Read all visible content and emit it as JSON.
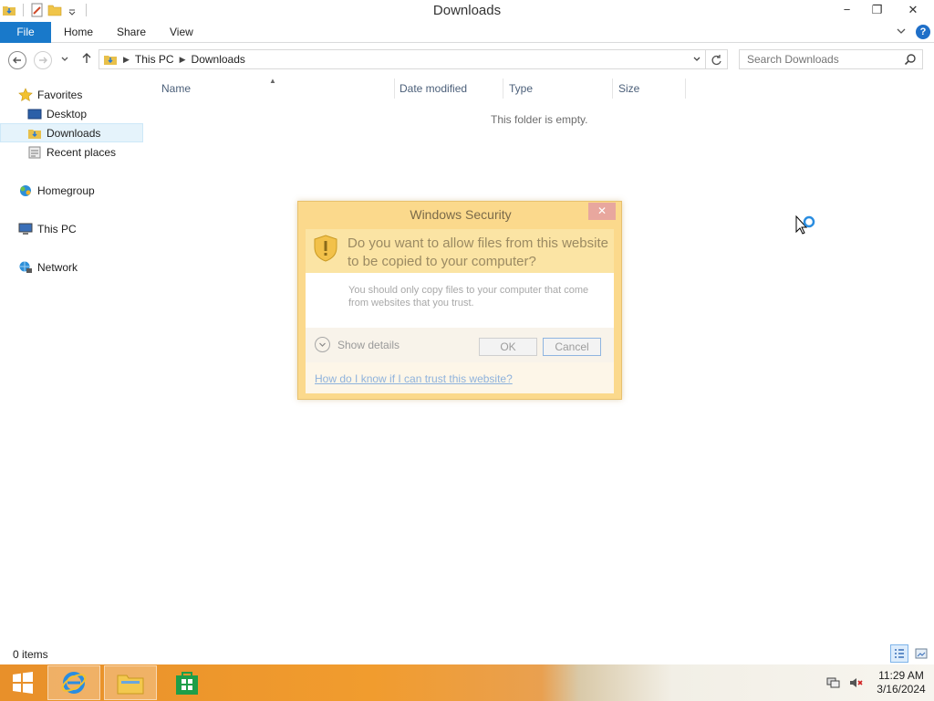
{
  "window": {
    "title": "Downloads",
    "controls": {
      "minimize": "−",
      "restore": "❐",
      "close": "✕"
    }
  },
  "ribbon": {
    "tabs": [
      "File",
      "Home",
      "Share",
      "View"
    ],
    "help": "?"
  },
  "address": {
    "crumbs": [
      "This PC",
      "Downloads"
    ],
    "search_placeholder": "Search Downloads"
  },
  "nav": {
    "favorites": "Favorites",
    "desktop": "Desktop",
    "downloads": "Downloads",
    "recent": "Recent places",
    "homegroup": "Homegroup",
    "thispc": "This PC",
    "network": "Network"
  },
  "columns": [
    "Name",
    "Date modified",
    "Type",
    "Size"
  ],
  "content": {
    "empty_message": "This folder is empty."
  },
  "status": {
    "item_count": "0 items"
  },
  "dialog": {
    "title": "Windows Security",
    "question": "Do you want to allow files from this website to be copied to your computer?",
    "description": "You should only copy files to your computer that come from websites that you trust.",
    "show_details": "Show details",
    "ok": "OK",
    "cancel": "Cancel",
    "help_link": "How do I know if I can trust this website?"
  },
  "taskbar": {
    "clock_time": "11:29 AM",
    "clock_date": "3/16/2024"
  },
  "colors": {
    "file_tab": "#1979ca",
    "dialog_frame": "#fbd98c",
    "taskbar_accent": "#f19c2e"
  }
}
